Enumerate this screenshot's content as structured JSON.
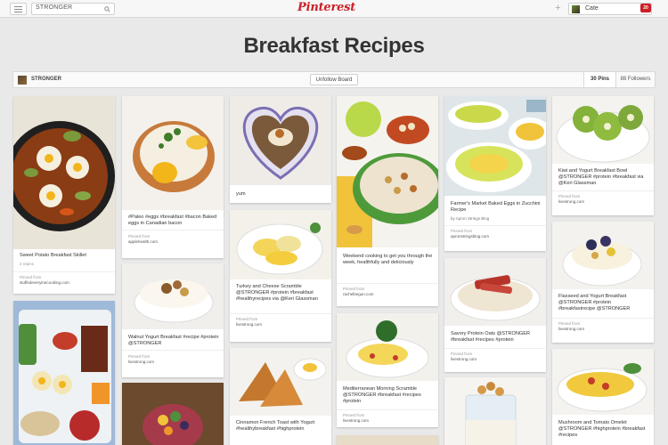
{
  "topbar": {
    "search_value": "STRONGER",
    "logo": "Pinterest",
    "add_symbol": "+",
    "user_name": "Cate",
    "notification_count": "20"
  },
  "board": {
    "title": "Breakfast Recipes",
    "owner": "STRONGER",
    "unfollow_label": "Unfollow Board",
    "pins_label": "30 Pins",
    "followers_label": "88 Followers"
  },
  "pins": [
    {
      "desc": "Sweet Potato Breakfast Skillet",
      "repins": "2 repins",
      "pinned_label": "Pinned from",
      "source": "stuffedeveryinecooking.com"
    },
    {
      "desc": "#Paleo #eggs #breakfast #bacon Baked eggs in Canadian bacon",
      "pinned_label": "Pinned from",
      "source": "applehealth.com"
    },
    {
      "desc": "Walnut Yogurt Breakfast #recipe #protein @STRONGER",
      "pinned_label": "Pinned from",
      "source": "livestrong.com"
    },
    {
      "desc": "yum"
    },
    {
      "desc": "Turkey and Cheese Scramble @STRONGER #protein #breakfast #healthyrecipes via @Keri Glassman",
      "pinned_label": "Pinned from",
      "source": "livestrong.com"
    },
    {
      "desc": "Cinnamon French Toast with Yogurt #healthybreakfast #highprotein"
    },
    {
      "desc": "Weekend cooking to get you through the week, healthfully and deliciously",
      "pinned_label": "Pinned from",
      "source": "rachelbegun.com"
    },
    {
      "desc": "Mediterranean Morning Scramble @STRONGER #breakfast #recipes #protein",
      "pinned_label": "Pinned from",
      "source": "livestrong.com"
    },
    {
      "desc": "Farmer's Market Baked Eggs in Zucchini Recipe",
      "board_label": "by Apron Strings Blog",
      "pinned_label": "Pinned from",
      "source": "apronstringsblog.com"
    },
    {
      "desc": "Savory Protein Oats @STRONGER #breakfast #recipes #protein",
      "pinned_label": "Pinned from",
      "source": "livestrong.com"
    },
    {
      "desc": "Kiwi and Yogurt Breakfast Bowl @STRONGER #protein #breakfast via @Keri Glassman",
      "pinned_label": "Pinned from",
      "source": "livestrong.com"
    },
    {
      "desc": "Flaxseed and Yogurt Breakfast @STRONGER #protein #breakfastrecipe @STRONGER",
      "pinned_label": "Pinned from",
      "source": "livestrong.com"
    },
    {
      "desc": "Mushroom and Tomato Omelet @STRONGER #highprotein #breakfast #recipes"
    }
  ],
  "colors": {
    "brand": "#cb2027",
    "background": "#e9e9e9"
  },
  "icons": [
    "menu-icon",
    "search-icon",
    "add-icon",
    "notification-badge"
  ]
}
